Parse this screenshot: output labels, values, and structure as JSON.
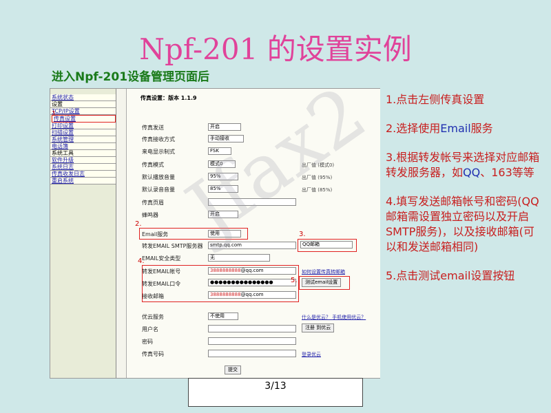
{
  "slide": {
    "title": "Npf-201 的设置实例",
    "subtitle": "进入Npf-201设备管理页面后",
    "page": "3/13",
    "watermark": "Jfax2"
  },
  "nav": {
    "items": [
      {
        "label": "系统状态",
        "type": "link"
      },
      {
        "label": "设置",
        "type": "group"
      },
      {
        "label": "TCP/IP设置",
        "type": "link"
      },
      {
        "label": "传真设置",
        "type": "link",
        "active": true
      },
      {
        "label": "打印设置",
        "type": "link"
      },
      {
        "label": "扫描设置",
        "type": "link"
      },
      {
        "label": "系统管理",
        "type": "link"
      },
      {
        "label": "电话簿",
        "type": "link"
      },
      {
        "label": "系统工具",
        "type": "group"
      },
      {
        "label": "软件升级",
        "type": "link"
      },
      {
        "label": "系统日志",
        "type": "link"
      },
      {
        "label": "传真收发日志",
        "type": "link"
      },
      {
        "label": "重启系统",
        "type": "link"
      }
    ]
  },
  "panel": {
    "version": "传真设置：版本 1.1.9",
    "fields": {
      "fax_send": {
        "label": "传真发送",
        "value": "开启"
      },
      "fax_receive_mode": {
        "label": "传真接收方式",
        "value": "手动接收"
      },
      "caller_id": {
        "label": "来电显示制式",
        "value": "FSK"
      },
      "fax_mode": {
        "label": "传真模式",
        "value": "模式0",
        "note": "出厂值 (模式0)"
      },
      "ring_volume": {
        "label": "默认播放音量",
        "value": "95%",
        "note": "出厂值 (95%)"
      },
      "record_volume": {
        "label": "默认录音音量",
        "value": "85%",
        "note": "出厂值 (85%)"
      },
      "fax_header": {
        "label": "传真页眉",
        "value": ""
      },
      "buzzer": {
        "label": "蜂鸣器",
        "value": "开启"
      },
      "email_service": {
        "label": "Email服务",
        "value": "使用"
      },
      "smtp_server": {
        "label": "转发EMAIL SMTP服务器",
        "value": "smtp.qq.com"
      },
      "mail_provider": {
        "value": "QQ邮箱"
      },
      "email_security": {
        "label": "EMAIL安全类型",
        "value": "无"
      },
      "email_account": {
        "label": "转发EMAIL帐号",
        "value_mask": "3888888888",
        "value_suffix": "@qq.com"
      },
      "email_password": {
        "label": "转发EMAIL口令",
        "value": "●●●●●●●●●●●●●●●"
      },
      "receive_mailbox": {
        "label": "接收邮箱",
        "value_mask": "3888888888",
        "value_suffix": "@qq.com"
      },
      "youyun_service": {
        "label": "优云服务",
        "value": "不使用"
      },
      "username": {
        "label": "用户名",
        "value": ""
      },
      "password": {
        "label": "密码",
        "value": ""
      },
      "fax_number": {
        "label": "传真号码",
        "value": ""
      }
    },
    "links": {
      "add_fax_mailbox": "如何设置传真转邮箱",
      "what_is_youyun": "什么是优云？  手机使用优云？",
      "login_youyun": "登录优云"
    },
    "buttons": {
      "test_email": "测试email设置",
      "register_youyun": "注册 到优云",
      "submit": "提交"
    },
    "markers": {
      "m1": "1.",
      "m2": "2.",
      "m3": "3.",
      "m4": "4.",
      "m5": "5."
    }
  },
  "steps": [
    {
      "pre": "1.点击左侧传真设置",
      "blue": ""
    },
    {
      "pre": "2.选择使用",
      "blue": "Email",
      "post": "服务"
    },
    {
      "pre": "3.根据转发帐号来选择对应邮箱转发服务器，如",
      "blue": "QQ",
      "post": "、163等等"
    },
    {
      "pre": "4.填写发送邮箱帐号和密码(QQ邮箱需设置独立密码以及开启SMTP服务)，以及接收邮箱(可以和发送邮箱相同)",
      "blue": ""
    },
    {
      "pre": "5.点击测试email设置按钮",
      "blue": ""
    }
  ],
  "colors": {
    "title": "#e0439a",
    "step_text": "#c81e1e",
    "marker_red": "#e02020",
    "background": "#cfe8e8"
  }
}
